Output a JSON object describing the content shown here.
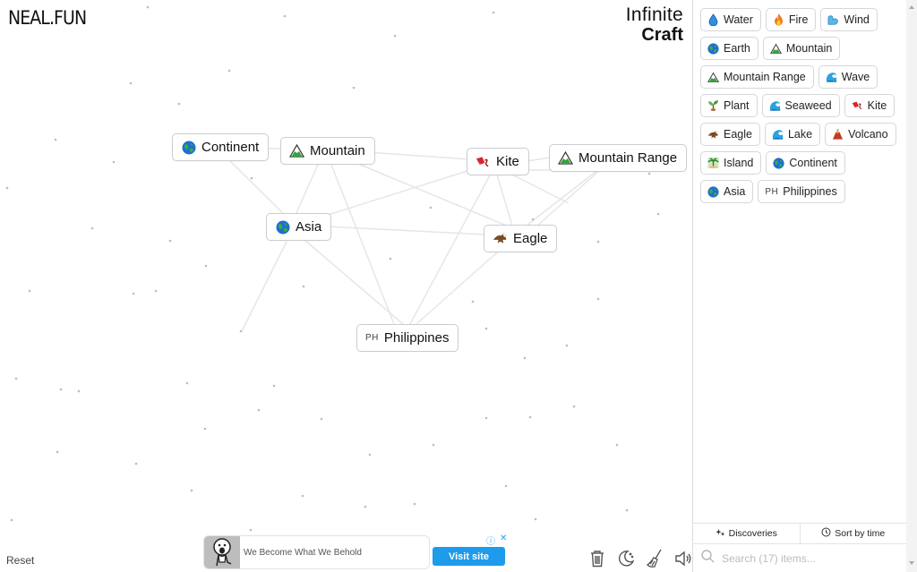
{
  "header": {
    "logo": "NEAL.FUN",
    "brand_line1": "Infinite",
    "brand_line2": "Craft"
  },
  "canvas": {
    "nodes": [
      {
        "id": "continent",
        "label": "Continent",
        "icon": "globe-icon"
      },
      {
        "id": "mountain",
        "label": "Mountain",
        "icon": "mountain-icon"
      },
      {
        "id": "kite",
        "label": "Kite",
        "icon": "kite-icon"
      },
      {
        "id": "mountain-range",
        "label": "Mountain Range",
        "icon": "mountain-icon"
      },
      {
        "id": "asia",
        "label": "Asia",
        "icon": "globe-icon"
      },
      {
        "id": "eagle",
        "label": "Eagle",
        "icon": "eagle-icon"
      },
      {
        "id": "philippines",
        "label": "Philippines",
        "icon": "flag-ph",
        "icon_text": "PH"
      }
    ],
    "reset_label": "Reset"
  },
  "ad": {
    "title": "We Become What We Behold",
    "button_label": "Visit site",
    "info_icon": "info-icon",
    "close_icon": "close-icon",
    "accent": "#1e9bea"
  },
  "toolbar": {
    "icons": [
      "trash-icon",
      "dark-mode-icon",
      "broom-icon",
      "sound-icon"
    ]
  },
  "sidebar": {
    "items": [
      {
        "label": "Water",
        "icon": "water-drop-icon"
      },
      {
        "label": "Fire",
        "icon": "fire-icon"
      },
      {
        "label": "Wind",
        "icon": "wind-icon"
      },
      {
        "label": "Earth",
        "icon": "globe-icon"
      },
      {
        "label": "Mountain",
        "icon": "mountain-icon"
      },
      {
        "label": "Mountain Range",
        "icon": "mountain-icon"
      },
      {
        "label": "Wave",
        "icon": "wave-icon"
      },
      {
        "label": "Plant",
        "icon": "plant-icon"
      },
      {
        "label": "Seaweed",
        "icon": "wave-icon"
      },
      {
        "label": "Kite",
        "icon": "kite-icon"
      },
      {
        "label": "Eagle",
        "icon": "eagle-icon"
      },
      {
        "label": "Lake",
        "icon": "wave-icon"
      },
      {
        "label": "Volcano",
        "icon": "volcano-icon"
      },
      {
        "label": "Island",
        "icon": "island-icon"
      },
      {
        "label": "Continent",
        "icon": "globe-icon"
      },
      {
        "label": "Asia",
        "icon": "globe-icon"
      },
      {
        "label": "Philippines",
        "icon": "flag-ph",
        "icon_text": "PH"
      }
    ],
    "tabs": {
      "discoveries": "Discoveries",
      "sort": "Sort by time"
    },
    "search_placeholder": "Search (17) items..."
  }
}
